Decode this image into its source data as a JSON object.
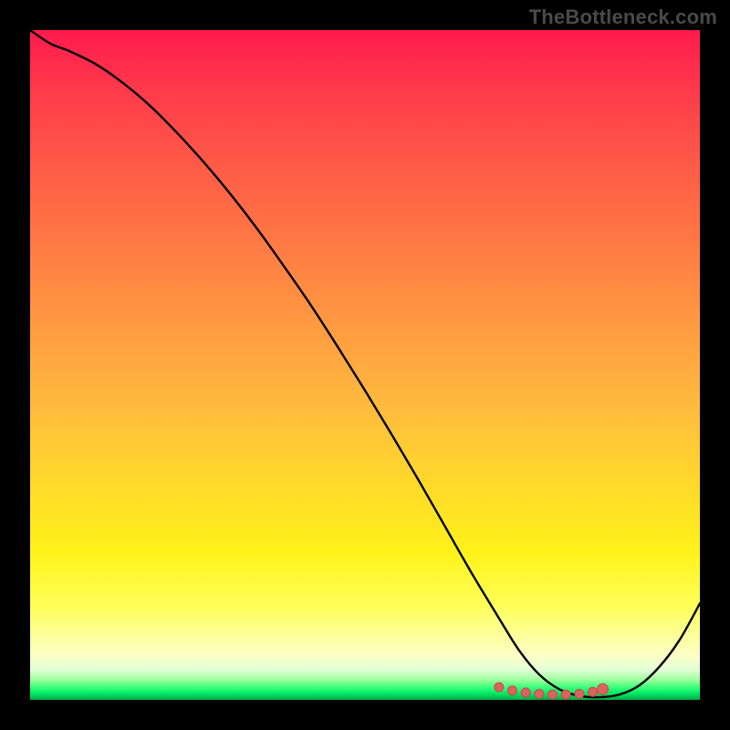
{
  "watermark": "TheBottleneck.com",
  "colors": {
    "frame": "#000000",
    "curve": "#000000",
    "marker_fill": "#d9635f",
    "marker_stroke": "#c94b47"
  },
  "chart_data": {
    "type": "line",
    "title": "",
    "xlabel": "",
    "ylabel": "",
    "xlim": [
      0,
      100
    ],
    "ylim": [
      0,
      100
    ],
    "grid": false,
    "series": [
      {
        "name": "curve",
        "x": [
          0,
          3,
          6,
          10,
          14,
          18,
          22,
          26,
          30,
          34,
          38,
          42,
          46,
          50,
          54,
          58,
          62,
          66,
          70,
          73,
          76,
          79,
          82,
          85,
          88,
          91,
          94,
          97,
          100
        ],
        "values": [
          100,
          98,
          96.8,
          94.8,
          92,
          88.6,
          84.6,
          80.2,
          75.4,
          70.2,
          64.6,
          58.8,
          52.6,
          46.2,
          39.6,
          32.8,
          25.8,
          18.8,
          12.2,
          7.4,
          3.8,
          1.6,
          0.6,
          0.4,
          0.8,
          2.2,
          5.0,
          9.0,
          14.4
        ]
      }
    ],
    "markers": {
      "name": "bottom-cluster",
      "x": [
        70,
        72,
        74,
        76,
        78,
        80,
        82,
        84,
        85.5
      ],
      "values": [
        1.9,
        1.4,
        1.1,
        0.9,
        0.8,
        0.8,
        0.9,
        1.2,
        1.6
      ]
    },
    "gradient_stops": [
      {
        "pct": 0,
        "color": "#ff1a4d"
      },
      {
        "pct": 20,
        "color": "#ff5a47"
      },
      {
        "pct": 44,
        "color": "#ff9a41"
      },
      {
        "pct": 68,
        "color": "#ffda2a"
      },
      {
        "pct": 86,
        "color": "#ffff5a"
      },
      {
        "pct": 95.5,
        "color": "#e3ffd7"
      },
      {
        "pct": 98.3,
        "color": "#2bff76"
      },
      {
        "pct": 100,
        "color": "#00aa46"
      }
    ]
  }
}
